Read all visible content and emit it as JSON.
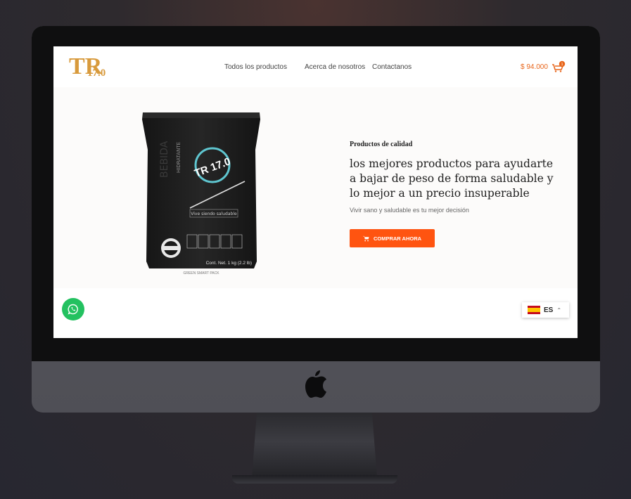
{
  "brand": {
    "logo_big": "R",
    "logo_small": "17.0",
    "logo_text": "TR17.0"
  },
  "nav": {
    "links": [
      "Todos los productos",
      "Acerca de nosotros",
      "Contactanos"
    ],
    "cart_total": "$ 94.000",
    "cart_count": "1"
  },
  "hero": {
    "eyebrow": "Productos de calidad",
    "headline": "los mejores productos para ayudarte a bajar de peso de forma saludable y lo mejor a un precio insuperable",
    "subtitle": "Vivir sano y saludable es tu mejor decisión",
    "cta_label": "COMPRAR AHORA"
  },
  "product": {
    "brand_mark": "TR 17.0",
    "vertical_text": "BEBIDA",
    "vertical_text_2": "HIDRATANTE",
    "tagline": "Vive siendo saludable",
    "net_content": "Cont. Net. 1 kg (2.2 lb)",
    "footer": "GREEN SMART PACK"
  },
  "language": {
    "code": "ES"
  },
  "colors": {
    "accent": "#ff5410",
    "logo": "#d89a3c",
    "whatsapp": "#23c160",
    "teal": "#5fc6d0"
  },
  "icons": [
    "apple-logo-icon",
    "cart-icon",
    "whatsapp-icon",
    "spain-flag-icon",
    "chevron-up-icon"
  ]
}
